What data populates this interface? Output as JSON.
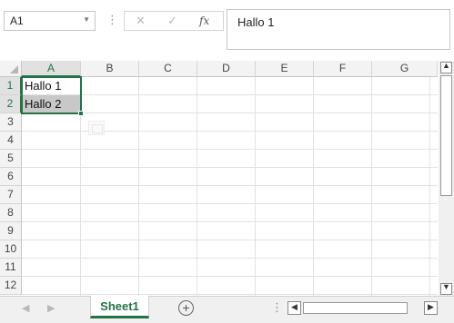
{
  "formula_bar": {
    "name_box": "A1",
    "name_box_arrow_icon": "chevron-down-icon",
    "more_icon": "vertical-dots-icon",
    "cancel_glyph": "✕",
    "enter_glyph": "✓",
    "function_glyph": "fx",
    "formula_value": "Hallo 1"
  },
  "grid": {
    "columns": [
      "A",
      "B",
      "C",
      "D",
      "E",
      "F",
      "G"
    ],
    "rows": [
      "1",
      "2",
      "3",
      "4",
      "5",
      "6",
      "7",
      "8",
      "9",
      "10",
      "11",
      "12"
    ],
    "selected_column": "A",
    "selected_rows": [
      "1",
      "2"
    ],
    "cells": {
      "A1": "Hallo 1",
      "A2": "Hallo 2"
    }
  },
  "sheet_tabs": {
    "active_tab": "Sheet1",
    "add_icon": "plus-circle-icon",
    "nav_left_glyph": "◀",
    "nav_right_glyph": "▶",
    "more_glyph": "⋮"
  },
  "scrollbars": {
    "up_glyph": "▲",
    "down_glyph": "▼",
    "left_glyph": "◀",
    "right_glyph": "▶"
  },
  "colors": {
    "accent": "#217346",
    "selected_cell_fill": "#c8c8c8",
    "header_fill": "#f3f3f3"
  }
}
